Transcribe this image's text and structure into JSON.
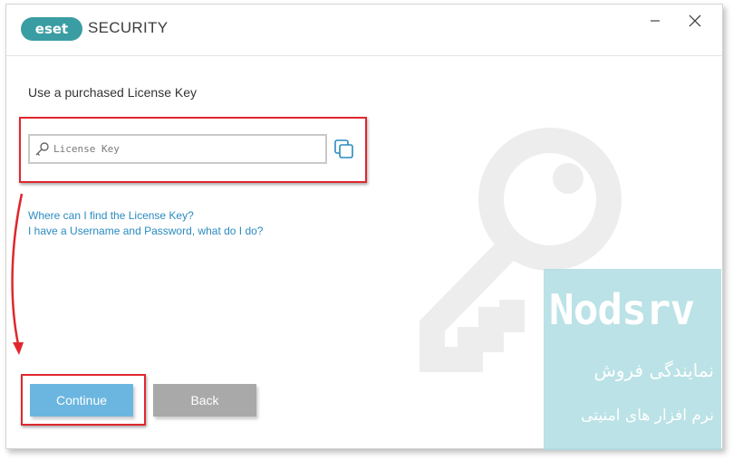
{
  "window": {
    "brand_logo_text": "eset",
    "brand_text": "SECURITY",
    "minimize_icon": "minimize-icon",
    "close_icon": "close-icon"
  },
  "main": {
    "heading": "Use a purchased License Key",
    "license_input": {
      "placeholder": "License Key",
      "value": "",
      "icon": "key-icon"
    },
    "paste_icon": "copy-icon",
    "links": [
      "Where can I find the License Key?",
      "I have a Username and Password, what do I do?"
    ],
    "buttons": {
      "continue": "Continue",
      "back": "Back"
    }
  },
  "watermark": {
    "title": "Nodsrv",
    "line1": "نمایندگی فروش",
    "line2": "نرم افزار های امنیتی"
  },
  "colors": {
    "accent": "#2a8bc0",
    "continue_button": "#6bb6e0",
    "back_button": "#a9a9a9",
    "highlight_red": "#e0272e",
    "watermark_panel": "#acdce1"
  }
}
